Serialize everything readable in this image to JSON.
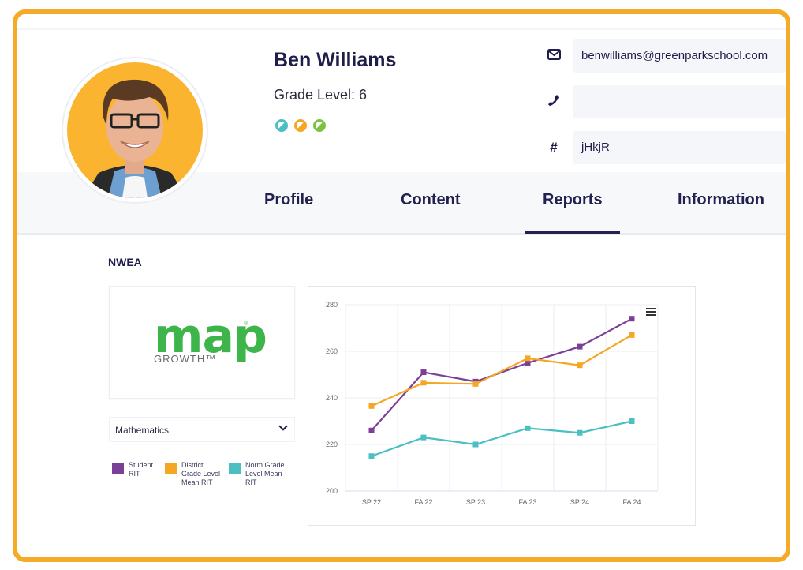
{
  "student": {
    "name": "Ben Williams",
    "grade_label": "Grade Level: 6",
    "badges": [
      {
        "name": "teal-badge",
        "color": "#4bbfc1"
      },
      {
        "name": "orange-badge",
        "color": "#f5a623"
      },
      {
        "name": "green-badge",
        "color": "#7cc242"
      }
    ]
  },
  "contact": {
    "email_icon": "envelope-icon",
    "email": "benwilliams@greenparkschool.com",
    "phone_icon": "phone-icon",
    "phone": "",
    "id_icon": "hash-icon",
    "id_symbol": "#",
    "code": "jHkjR"
  },
  "tabs": [
    {
      "label": "Profile",
      "active": false
    },
    {
      "label": "Content",
      "active": false
    },
    {
      "label": "Reports",
      "active": true
    },
    {
      "label": "Information",
      "active": false
    }
  ],
  "report": {
    "section_title": "NWEA",
    "logo": {
      "word": "map",
      "reg": "®",
      "sub": "GROWTH™"
    },
    "subject_select": "Mathematics",
    "menu_icon": "hamburger-menu-icon"
  },
  "colors": {
    "accent_frame": "#f5ab27",
    "navy": "#1f1d4a",
    "student": "#7b3f98",
    "district": "#f5a623",
    "norm": "#4bbfc1"
  },
  "chart_data": {
    "type": "line",
    "title": "",
    "xlabel": "",
    "ylabel": "",
    "categories": [
      "SP 22",
      "FA 22",
      "SP 23",
      "FA 23",
      "SP 24",
      "FA 24"
    ],
    "ylim": [
      200,
      280
    ],
    "yticks": [
      200,
      220,
      240,
      260,
      280
    ],
    "grid": true,
    "legend_position": "bottom-left-outside",
    "series": [
      {
        "name": "Student RIT",
        "color": "#7b3f98",
        "values": [
          226,
          251,
          247,
          255,
          262,
          274
        ]
      },
      {
        "name": "District Grade Level Mean RIT",
        "color": "#f5a623",
        "values": [
          236.5,
          246.5,
          246,
          257,
          254,
          267
        ]
      },
      {
        "name": "Norm Grade Level Mean RIT",
        "color": "#4bbfc1",
        "values": [
          215,
          223,
          220,
          227,
          225,
          230
        ]
      }
    ]
  }
}
